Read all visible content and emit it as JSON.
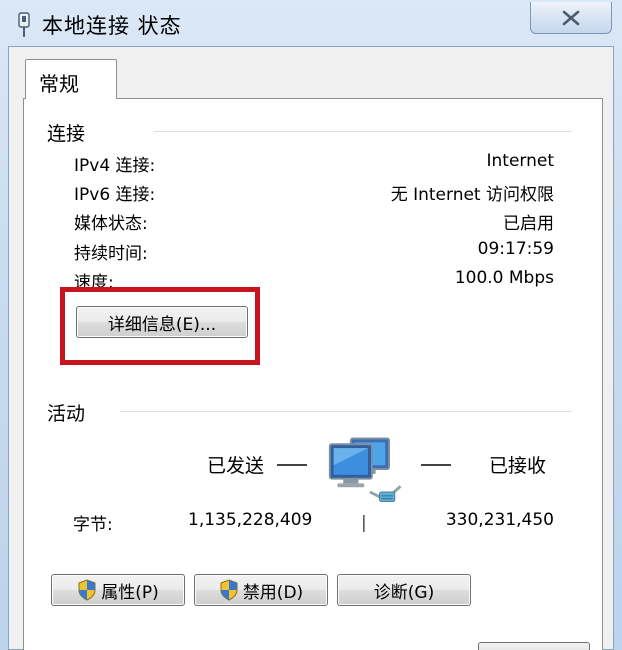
{
  "window": {
    "title": "本地连接 状态",
    "close_glyph": "✕"
  },
  "tabs": [
    {
      "label": "常规",
      "selected": true
    }
  ],
  "connection": {
    "header": "连接",
    "rows": [
      {
        "label": "IPv4 连接:",
        "value": "Internet"
      },
      {
        "label": "IPv6 连接:",
        "value": "无 Internet 访问权限"
      },
      {
        "label": "媒体状态:",
        "value": "已启用"
      },
      {
        "label": "持续时间:",
        "value": "09:17:59"
      },
      {
        "label": "速度:",
        "value": "100.0 Mbps"
      }
    ],
    "details_button": "详细信息(E)..."
  },
  "activity": {
    "header": "活动",
    "sent_label": "已发送",
    "received_label": "已接收",
    "bytes_label": "字节:",
    "bytes_sent": "1,135,228,409",
    "bytes_received": "330,231,450",
    "separator": "|"
  },
  "buttons": {
    "properties": "属性(P)",
    "disable": "禁用(D)",
    "diagnose": "诊断(G)"
  },
  "colors": {
    "highlight": "#c8141e",
    "title_bg": "#c9dcf0"
  },
  "icons": [
    "network-adapter-icon",
    "close-icon",
    "network-computers-icon",
    "shield-icon"
  ]
}
